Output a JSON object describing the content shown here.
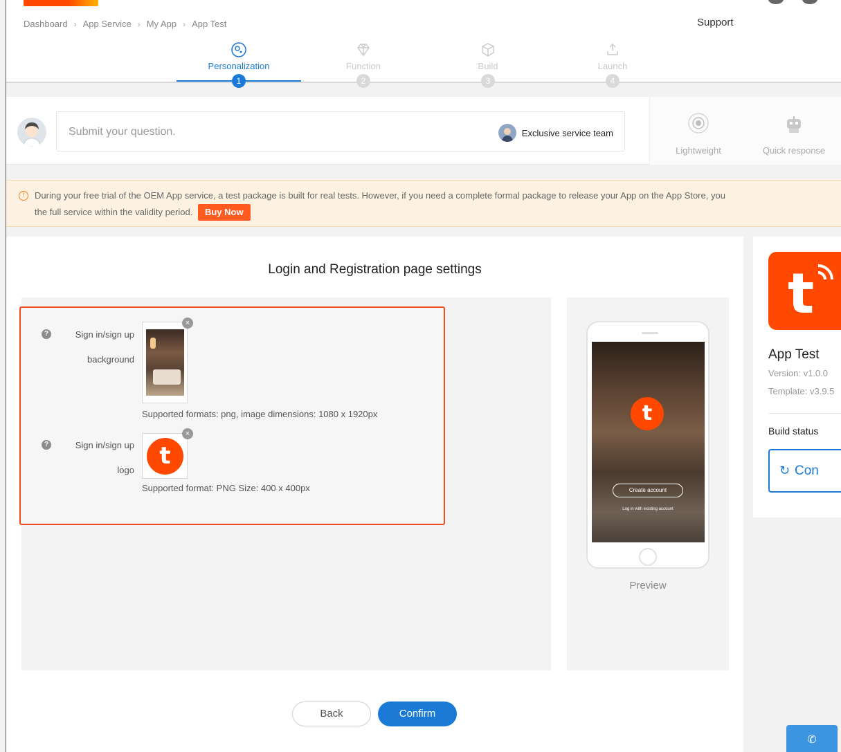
{
  "breadcrumb": [
    "Dashboard",
    "App Service",
    "My App",
    "App Test"
  ],
  "support_label": "Support",
  "steps": [
    {
      "label": "Personalization",
      "num": "1",
      "icon": "palette-icon",
      "active": true
    },
    {
      "label": "Function",
      "num": "2",
      "icon": "diamond-icon",
      "active": false
    },
    {
      "label": "Build",
      "num": "3",
      "icon": "box-icon",
      "active": false
    },
    {
      "label": "Launch",
      "num": "4",
      "icon": "upload-icon",
      "active": false
    }
  ],
  "question": {
    "placeholder": "Submit your question.",
    "exclusive_label": "Exclusive service team"
  },
  "features": [
    {
      "label": "Lightweight",
      "icon": "target-icon"
    },
    {
      "label": "Quick response",
      "icon": "robot-icon"
    }
  ],
  "notice": {
    "line1": "During your free trial of the OEM App service, a test package is built for real tests. However, if you need a complete formal package to release your App on the App Store, you",
    "line2": "the full service within the validity period.",
    "buy_label": "Buy Now"
  },
  "main": {
    "title": "Login and Registration page settings",
    "background": {
      "label_line1": "Sign in/sign up",
      "label_line2": "background",
      "hint": "Supported formats: png, image dimensions: 1080 x 1920px"
    },
    "logo": {
      "label_line1": "Sign in/sign up",
      "label_line2": "logo",
      "hint": "Supported format: PNG Size: 400 x 400px"
    },
    "preview": {
      "label": "Preview",
      "create_account": "Create account",
      "login_text": "Log in with existing account"
    },
    "back_label": "Back",
    "confirm_label": "Confirm"
  },
  "sidebar": {
    "app_name": "App Test",
    "version": "Version: v1.0.0",
    "template": "Template: v3.9.5",
    "build_status_label": "Build status",
    "con_button_label": "Con"
  },
  "colors": {
    "accent": "#1a7ad6",
    "brand_orange": "#ff4800",
    "notice_bg": "#fdf1e2"
  }
}
